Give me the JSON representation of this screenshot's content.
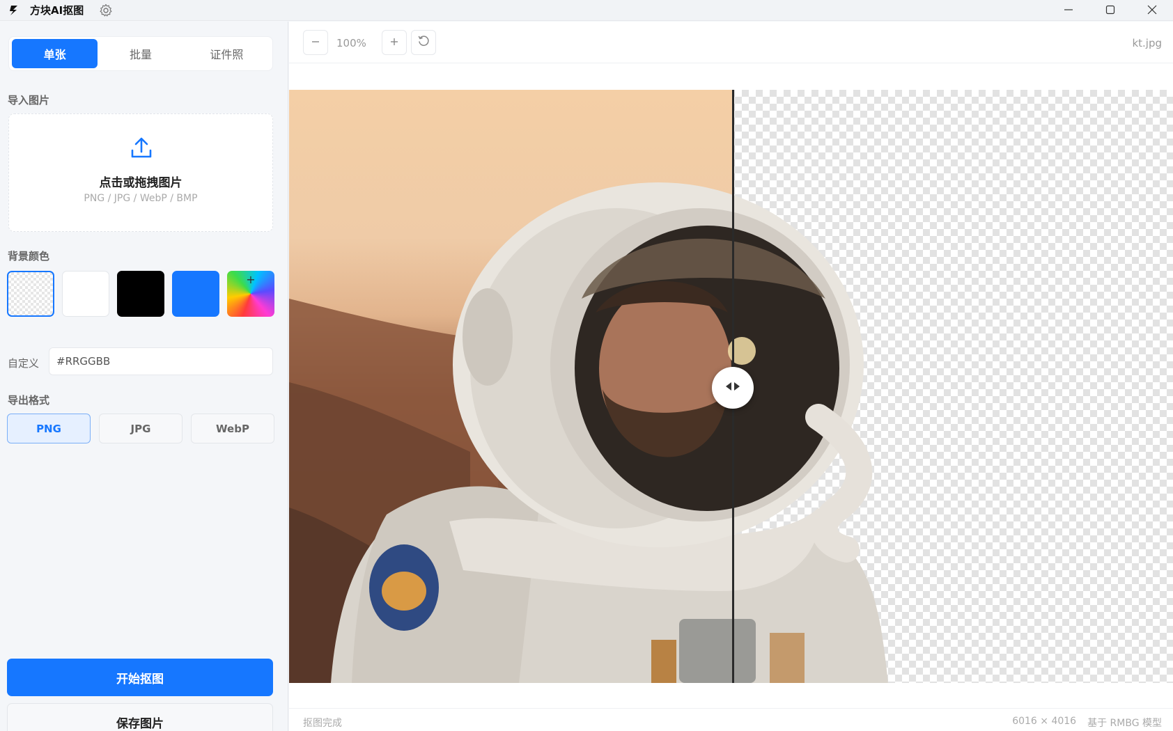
{
  "window": {
    "title": "方块AI抠图",
    "icons": {
      "logo": "lightning-logo-icon",
      "settings": "gear-icon",
      "minimize": "minimize-icon",
      "maximize": "maximize-icon",
      "close": "close-icon"
    }
  },
  "sidebar": {
    "mode_tabs": [
      {
        "label": "单张",
        "active": true
      },
      {
        "label": "批量",
        "active": false
      },
      {
        "label": "证件照",
        "active": false
      }
    ],
    "import": {
      "section_label": "导入图片",
      "icon": "upload-icon",
      "title": "点击或拖拽图片",
      "formats_hint": "PNG / JPG / WebP / BMP"
    },
    "background": {
      "section_label": "背景颜色",
      "swatches": [
        {
          "name": "transparent",
          "color": "transparent",
          "selected": true
        },
        {
          "name": "white",
          "color": "#ffffff",
          "selected": false
        },
        {
          "name": "black",
          "color": "#000000",
          "selected": false
        },
        {
          "name": "blue",
          "color": "#1677ff",
          "selected": false
        },
        {
          "name": "custom-picker",
          "color": "rainbow",
          "symbol": "+",
          "selected": false
        }
      ],
      "custom_label": "自定义",
      "custom_placeholder": "#RRGGBB"
    },
    "export": {
      "section_label": "导出格式",
      "formats": [
        {
          "label": "PNG",
          "active": true
        },
        {
          "label": "JPG",
          "active": false
        },
        {
          "label": "WebP",
          "active": false
        }
      ]
    },
    "start_button": "开始抠图",
    "save_button": "保存图片"
  },
  "toolbar": {
    "zoom_out_icon": "minus-icon",
    "zoom_level": "100%",
    "zoom_in_icon": "plus-icon",
    "reset_icon": "rotate-reset-icon",
    "file_name": "kt.jpg"
  },
  "preview": {
    "compare_handle_icon": "left-right-arrows-icon",
    "accent": "#1677ff"
  },
  "status": {
    "left": "抠图完成",
    "dimensions": "6016 × 4016",
    "model": "基于 RMBG 模型"
  }
}
